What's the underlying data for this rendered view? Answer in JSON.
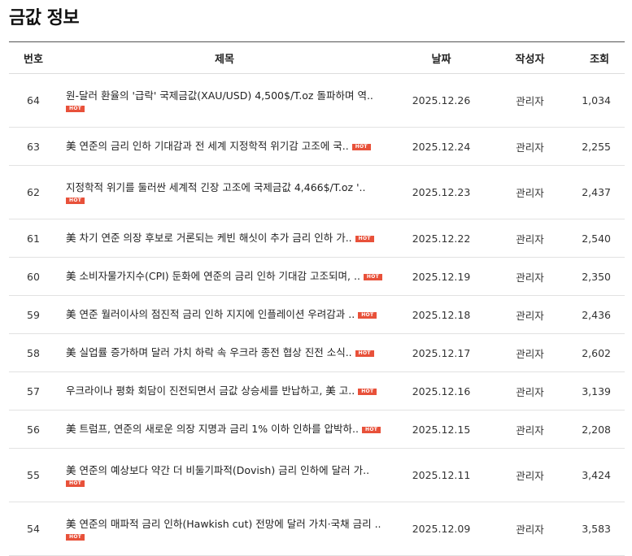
{
  "page": {
    "title": "금값 정보"
  },
  "table": {
    "headers": {
      "number": "번호",
      "title": "제목",
      "date": "날짜",
      "author": "작성자",
      "views": "조회"
    },
    "rows": [
      {
        "number": "64",
        "title": "원-달러 환율의 '급락' 국제금값(XAU/USD) 4,500$/T.oz 돌파하며 역..",
        "badge": "HOT",
        "date": "2025.12.26",
        "author": "관리자",
        "views": "1,034",
        "wrap": true
      },
      {
        "number": "63",
        "title": "美 연준의 금리 인하 기대감과 전 세계 지정학적 위기감 고조에 국..",
        "badge": "HOT",
        "date": "2025.12.24",
        "author": "관리자",
        "views": "2,255",
        "wrap": false
      },
      {
        "number": "62",
        "title": "지정학적 위기를 둘러싼 세계적 긴장 고조에 국제금값 4,466$/T.oz '..",
        "badge": "HOT",
        "date": "2025.12.23",
        "author": "관리자",
        "views": "2,437",
        "wrap": true
      },
      {
        "number": "61",
        "title": "美 차기 연준 의장 후보로 거론되는 케빈 해싯이 추가 금리 인하 가..",
        "badge": "HOT",
        "date": "2025.12.22",
        "author": "관리자",
        "views": "2,540",
        "wrap": false
      },
      {
        "number": "60",
        "title": "美 소비자물가지수(CPI) 둔화에 연준의 금리 인하 기대감 고조되며, ..",
        "badge": "HOT",
        "date": "2025.12.19",
        "author": "관리자",
        "views": "2,350",
        "wrap": false
      },
      {
        "number": "59",
        "title": "美 연준 월러이사의 점진적 금리 인하 지지에 인플레이션 우려감과 ..",
        "badge": "HOT",
        "date": "2025.12.18",
        "author": "관리자",
        "views": "2,436",
        "wrap": false
      },
      {
        "number": "58",
        "title": "美 실업률 증가하며 달러 가치 하락 속 우크라 종전 협상 진전 소식..",
        "badge": "HOT",
        "date": "2025.12.17",
        "author": "관리자",
        "views": "2,602",
        "wrap": false
      },
      {
        "number": "57",
        "title": "우크라이나 평화 회담이 진전되면서 금값 상승세를 반납하고, 美 고..",
        "badge": "HOT",
        "date": "2025.12.16",
        "author": "관리자",
        "views": "3,139",
        "wrap": false
      },
      {
        "number": "56",
        "title": "美 트럼프, 연준의 새로운 의장 지명과 금리 1% 이하 인하를 압박하..",
        "badge": "HOT",
        "date": "2025.12.15",
        "author": "관리자",
        "views": "2,208",
        "wrap": false
      },
      {
        "number": "55",
        "title": "美 연준의 예상보다 약간 더 비둘기파적(Dovish) 금리 인하에 달러 가..",
        "badge": "HOT",
        "date": "2025.12.11",
        "author": "관리자",
        "views": "3,424",
        "wrap": true
      },
      {
        "number": "54",
        "title": "美 연준의 매파적 금리 인하(Hawkish cut) 전망에 달러 가치·국채 금리 ..",
        "badge": "HOT",
        "date": "2025.12.09",
        "author": "관리자",
        "views": "3,583",
        "wrap": true
      }
    ]
  },
  "colors": {
    "hot_badge": "#e8513a",
    "header_border": "#555555",
    "row_border": "#e2e2e2"
  }
}
